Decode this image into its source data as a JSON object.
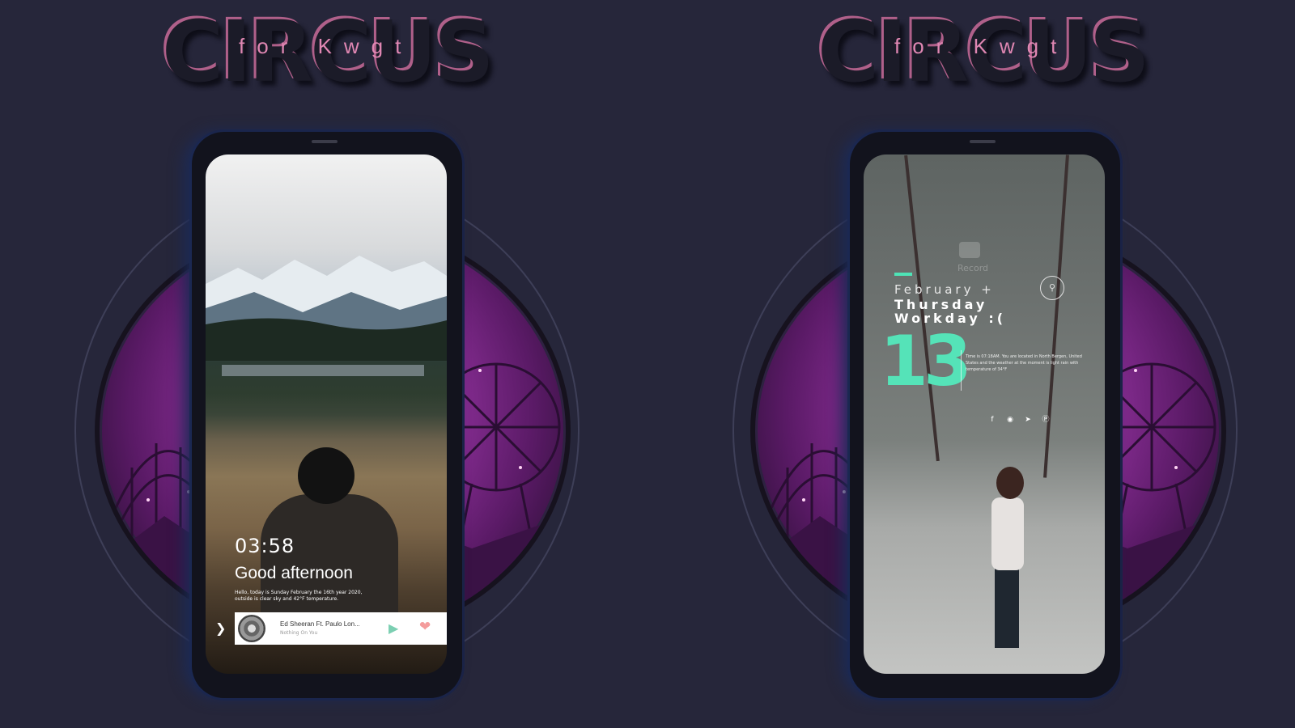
{
  "panels": {
    "left": {
      "logo": {
        "title": "CIRCUS",
        "subtitle": "for Kwgt"
      },
      "screen": {
        "clock": "03:58",
        "greeting": "Good afternoon",
        "description": "Hello, today is Sunday February the 16th year 2020, outside is clear sky and 42°F temperature.",
        "music": {
          "song": "Ed Sheeran Ft. Paulo Lon...",
          "artist": "Nothing On You",
          "arrow_icon": "chevron-right-icon",
          "play_icon": "play-icon",
          "heart_icon": "heart-icon"
        }
      }
    },
    "right": {
      "logo": {
        "title": "CIRCUS",
        "subtitle": "for Kwgt"
      },
      "screen": {
        "record_label": "Record",
        "month": "February +",
        "weekday": "Thursday",
        "workday": "Workday :(",
        "day": "13",
        "info": "Time is 07:18AM. You are located in North Bergen, United States and the weather at the moment is light rain with temperature of 34°F",
        "search_icon": "search-icon",
        "socials": [
          "facebook-icon",
          "instagram-icon",
          "twitter-icon",
          "pinterest-icon"
        ]
      }
    }
  },
  "colors": {
    "background": "#26263a",
    "accent_pink": "#e087b3",
    "accent_mint": "#55e3b8",
    "disc_purple": "#8b2f97"
  }
}
